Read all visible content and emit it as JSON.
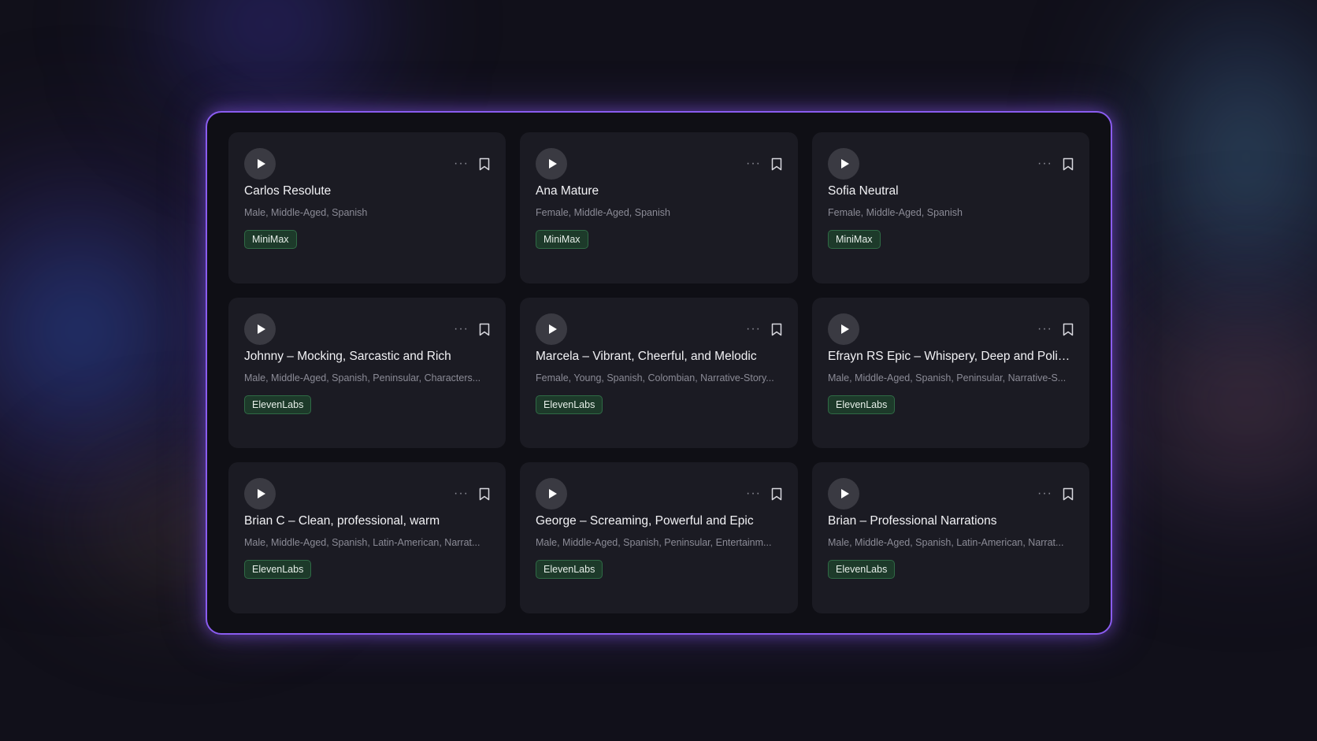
{
  "colors": {
    "panel_border": "#8a5cf0",
    "card_bg": "#1b1b23",
    "tag_bg": "#1d3a2a",
    "tag_border": "#2f6a45"
  },
  "icons": {
    "play": "play-icon",
    "more": "more-horizontal-icon",
    "bookmark": "bookmark-icon"
  },
  "voices": [
    {
      "name": "Carlos Resolute",
      "description": "Male, Middle-Aged, Spanish",
      "provider": "MiniMax"
    },
    {
      "name": "Ana Mature",
      "description": "Female, Middle-Aged, Spanish",
      "provider": "MiniMax"
    },
    {
      "name": "Sofia Neutral",
      "description": "Female, Middle-Aged, Spanish",
      "provider": "MiniMax"
    },
    {
      "name": "Johnny – Mocking, Sarcastic and Rich",
      "description": "Male, Middle-Aged, Spanish, Peninsular, Characters...",
      "provider": "ElevenLabs"
    },
    {
      "name": "Marcela – Vibrant, Cheerful, and Melodic",
      "description": "Female, Young, Spanish, Colombian, Narrative-Story...",
      "provider": "ElevenLabs"
    },
    {
      "name": "Efrayn RS Epic – Whispery, Deep and Polish...",
      "description": "Male, Middle-Aged, Spanish, Peninsular, Narrative-S...",
      "provider": "ElevenLabs"
    },
    {
      "name": "Brian C – Clean, professional, warm",
      "description": "Male, Middle-Aged, Spanish, Latin-American, Narrat...",
      "provider": "ElevenLabs"
    },
    {
      "name": "George – Screaming, Powerful and Epic",
      "description": "Male, Middle-Aged, Spanish, Peninsular, Entertainm...",
      "provider": "ElevenLabs"
    },
    {
      "name": "Brian – Professional Narrations",
      "description": "Male, Middle-Aged, Spanish, Latin-American, Narrat...",
      "provider": "ElevenLabs"
    }
  ]
}
